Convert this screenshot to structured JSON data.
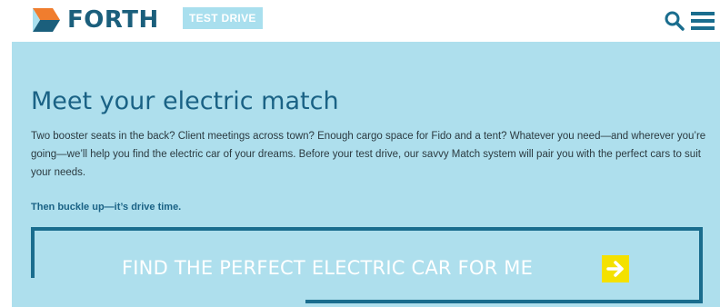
{
  "header": {
    "logo_text": "FORTH",
    "badge": "TEST DRIVE",
    "icons": {
      "search": "search-icon",
      "menu": "hamburger-menu-icon",
      "logo": "forth-logo-mark"
    }
  },
  "hero": {
    "title": "Meet your electric match",
    "body": "Two booster seats in the back? Client meetings across town? Enough cargo space for Fido and a tent? Whatever you need—and wherever you’re going—we’ll help you find the electric car of your dreams. Before your test drive, our savvy Match system will pair you with the perfect cars to suit your needs.",
    "tagline": "Then buckle up—it’s drive time.",
    "cta_label": "FIND THE PERFECT ELECTRIC CAR FOR ME",
    "cta_icon": "arrow-right-icon"
  },
  "colors": {
    "brand_dark": "#1b5f7c",
    "brand_orange": "#f07d2e",
    "hero_bg": "#aedfed",
    "cta_border": "#1a6d8e",
    "cta_arrow_bg": "#f4e100",
    "badge_bg": "#a9dfee"
  }
}
